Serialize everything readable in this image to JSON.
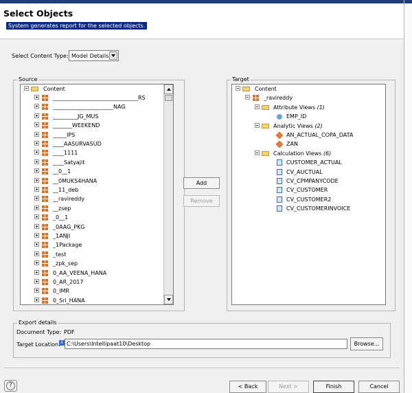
{
  "dialog": {
    "title": "Select Objects",
    "description": "System generates report for the selected objects."
  },
  "content_type": {
    "label": "Select Content Type:",
    "value": "Model Details"
  },
  "source": {
    "legend": "Source",
    "root": "Content",
    "items": [
      "_______________________________RS",
      "______________________NAG",
      "_________JG_MUS",
      "_______WEEKEND",
      "_____IPS",
      "____AASURVASUD",
      "____1111",
      "____Satyajit",
      "__0__1",
      "__0MUKS4HANA",
      "__11_deb",
      "__ravireddy",
      "__zsep",
      "_0__1",
      "_0AAG_PKG",
      "_1ANJI",
      "_1Package",
      "_test",
      "_zpk_sep",
      "0_AA_VEENA_HANA",
      "0_AR_2017",
      "0_IMR",
      "0_Sri_HANA"
    ]
  },
  "target": {
    "legend": "Target",
    "root": "Content",
    "package": "_ravireddy",
    "groups": [
      {
        "label": "Attribute Views",
        "count": "(1)",
        "icon": "attribute-view-icon",
        "items": [
          "EMP_ID"
        ]
      },
      {
        "label": "Analytic Views",
        "count": "(2)",
        "icon": "analytic-view-icon",
        "items": [
          "AN_ACTUAL_COPA_DATA",
          "ZAN"
        ]
      },
      {
        "label": "Calculation Views",
        "count": "(6)",
        "icon": "calculation-view-icon",
        "items": [
          "CUSTOMER_ACTUAL",
          "CV_AUCTUAL",
          "CV_CPMPANYCODE",
          "CV_CUSTOMER",
          "CV_CUSTOMER2",
          "CV_CUSTOMERINVOICE"
        ]
      }
    ]
  },
  "buttons": {
    "add": "Add",
    "remove": "Remove",
    "browse": "Browse...",
    "back": "< Back",
    "next": "Next >",
    "finish": "Finish",
    "cancel": "Cancel",
    "help": "?"
  },
  "export": {
    "legend": "Export details",
    "doc_type_label": "Document Type:",
    "doc_type_value": "PDF",
    "location_label": "Target Location:",
    "location_value": "C:\\Users\\Intellipaat10\\Desktop"
  },
  "colors": {
    "title_bar": "#1f3f7a",
    "description_highlight": "#0b2a85",
    "package_icon": "#e06f2a",
    "folder_icon": "#f5d36b"
  }
}
